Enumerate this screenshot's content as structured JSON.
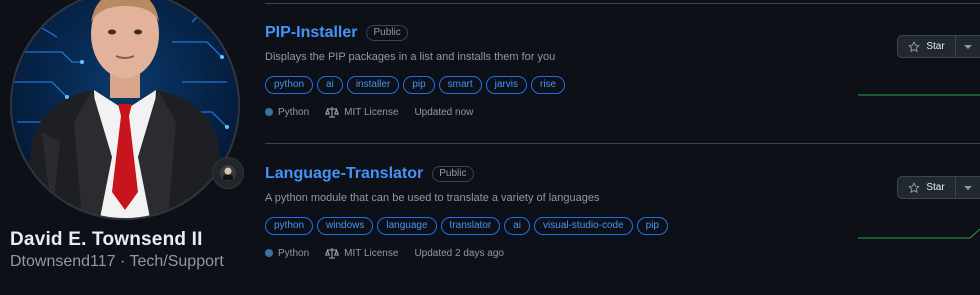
{
  "profile": {
    "name": "David E. Townsend II",
    "login_line": "Dtownsend117 · Tech/Support"
  },
  "repos": [
    {
      "name": "PIP-Installer",
      "visibility": "Public",
      "description": "Displays the PIP packages in a list and installs them for you",
      "topics": [
        "python",
        "ai",
        "installer",
        "pip",
        "smart",
        "jarvis",
        "rise"
      ],
      "language": "Python",
      "license": "MIT License",
      "updated": "Updated now",
      "star_label": "Star"
    },
    {
      "name": "Language-Translator",
      "visibility": "Public",
      "description": "A python module that can be used to translate a variety of languages",
      "topics": [
        "python",
        "windows",
        "language",
        "translator",
        "ai",
        "visual-studio-code",
        "pip"
      ],
      "language": "Python",
      "license": "MIT License",
      "updated": "Updated 2 days ago",
      "star_label": "Star"
    }
  ],
  "colors": {
    "link": "#4493f8",
    "python": "#3572A5",
    "spark": "#2ea043"
  },
  "icons": {
    "star": "star-icon",
    "license": "law-icon",
    "caret": "triangle-down-icon",
    "status": "status-emoji-icon"
  }
}
